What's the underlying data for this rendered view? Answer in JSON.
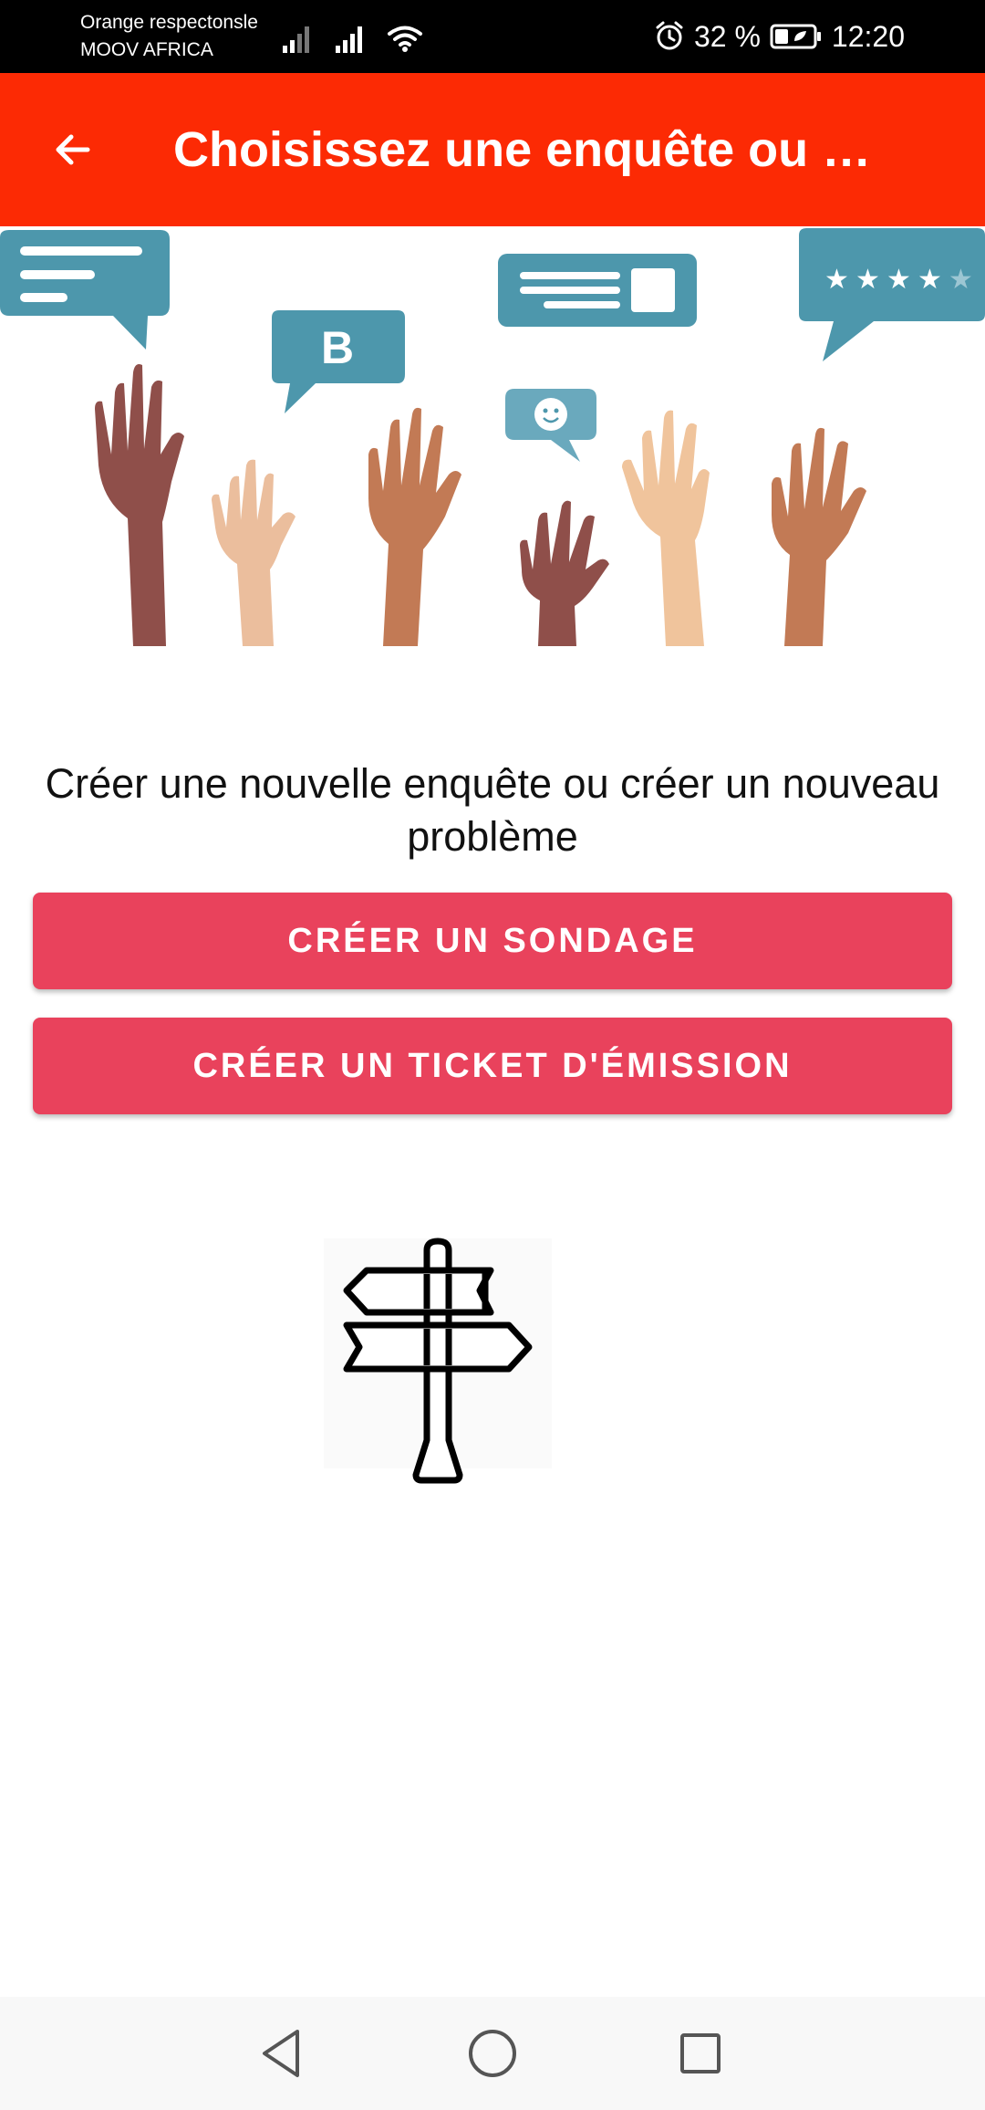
{
  "status_bar": {
    "carrier_line1": "Orange respectonsle",
    "carrier_line2": "MOOV AFRICA",
    "battery_percent": "32 %",
    "time": "12:20",
    "icons": [
      "signal-weak-icon",
      "signal-full-icon",
      "wifi-icon",
      "alarm-icon",
      "battery-icon"
    ]
  },
  "app_bar": {
    "title": "Choisissez une enquête ou …",
    "back_icon": "arrow-left-icon",
    "color": "#fc2a04"
  },
  "main": {
    "prompt": "Créer une nouvelle enquête ou créer un nouveau problème",
    "survey_button_label": "CRÉER UN SONDAGE",
    "ticket_button_label": "CRÉER UN TICKET D'ÉMISSION",
    "button_color": "#e9425c",
    "hero_illustration": "raised-hands-feedback-illustration",
    "signpost_icon": "signpost-icon"
  },
  "nav_bar": {
    "icons": [
      "back-triangle-icon",
      "home-circle-icon",
      "recents-square-icon"
    ]
  }
}
